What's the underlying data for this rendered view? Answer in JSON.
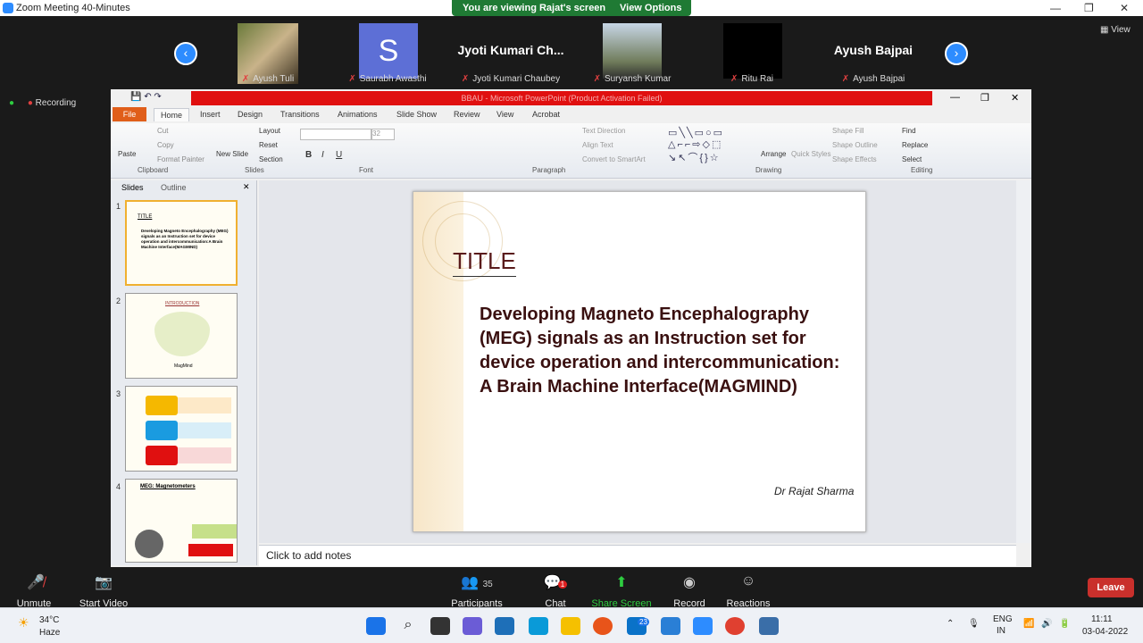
{
  "window": {
    "title": "Zoom Meeting 40-Minutes",
    "min": "—",
    "restore": "❐",
    "close": "✕"
  },
  "banner": {
    "viewing": "You are viewing Rajat's screen",
    "view_options": "View Options ⌄"
  },
  "gallery": [
    {
      "name": "Ayush Tuli",
      "label": ""
    },
    {
      "name": "Saurabh Awasthi",
      "label": "S"
    },
    {
      "name": "Jyoti Kumari Chaubey",
      "label": "Jyoti Kumari Ch..."
    },
    {
      "name": "Suryansh Kumar",
      "label": ""
    },
    {
      "name": "Ritu Rai",
      "label": ""
    },
    {
      "name": "Ayush Bajpai",
      "label": "Ayush Bajpai"
    }
  ],
  "view_label": "View",
  "recording": "Recording",
  "ppt": {
    "title": "BBAU - Microsoft PowerPoint (Product Activation Failed)",
    "file_tab": "File",
    "tabs": [
      "Home",
      "Insert",
      "Design",
      "Transitions",
      "Animations",
      "Slide Show",
      "Review",
      "View",
      "Acrobat"
    ],
    "ribbon": {
      "clipboard": [
        "Paste",
        "Cut",
        "Copy",
        "Format Painter"
      ],
      "slides": [
        "New Slide",
        "Layout",
        "Reset",
        "Section"
      ],
      "font_size": "32",
      "paragraph": [
        "Text Direction",
        "Align Text",
        "Convert to SmartArt"
      ],
      "drawing": [
        "Arrange",
        "Quick Styles",
        "Shape Fill",
        "Shape Outline",
        "Shape Effects"
      ],
      "editing": [
        "Find",
        "Replace",
        "Select"
      ],
      "groups": [
        "Clipboard",
        "Slides",
        "Font",
        "Paragraph",
        "Drawing",
        "Editing"
      ]
    },
    "pane_tabs": [
      "Slides",
      "Outline"
    ],
    "thumbs": [
      {
        "num": "1",
        "title": "TITLE",
        "body": "Developing Magneto Encephalography (MEG) signals as an Instruction set for device operation and intercommunication:A Brain Machine Interface(MAGMIND)"
      },
      {
        "num": "2",
        "title": "INTRODUCTION",
        "body": "MagMind"
      },
      {
        "num": "3",
        "title": "",
        "body": ""
      },
      {
        "num": "4",
        "title": "MEG: Magnetometers",
        "body": ""
      }
    ],
    "slide": {
      "title": "TITLE",
      "body": "Developing Magneto Encephalography (MEG) signals as an Instruction set for device operation and intercommunication: A Brain Machine Interface(MAGMIND)",
      "author": "Dr  Rajat Sharma"
    },
    "notes": "Click to add notes"
  },
  "toolbar": {
    "unmute": "Unmute",
    "start_video": "Start Video",
    "participants": "Participants",
    "participants_count": "35",
    "chat": "Chat",
    "chat_badge": "1",
    "share": "Share Screen",
    "record": "Record",
    "reactions": "Reactions",
    "leave": "Leave"
  },
  "taskbar": {
    "weather_temp": "34°C",
    "weather_desc": "Haze",
    "lang1": "ENG",
    "lang2": "IN",
    "time": "11:11",
    "date": "03-04-2022",
    "badge": "23"
  }
}
